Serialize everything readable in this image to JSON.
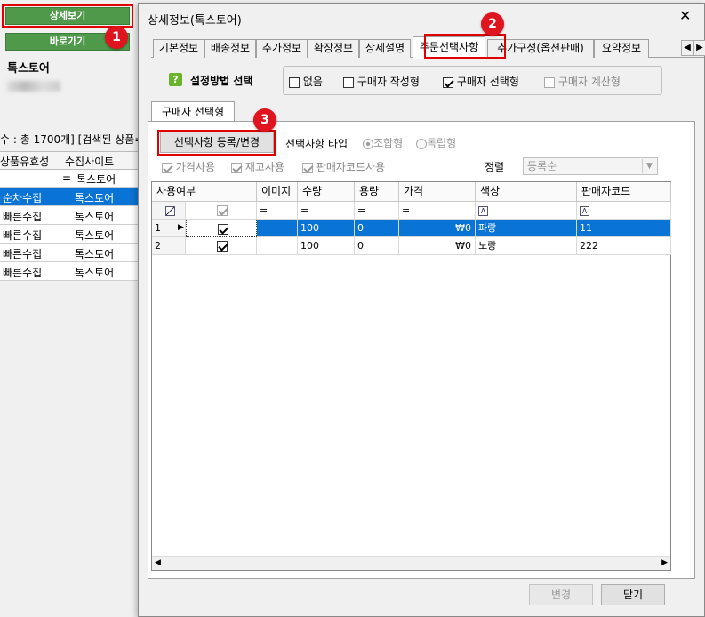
{
  "bg": {
    "detail_btn": "상세보기",
    "goto_btn": "바로가기",
    "store_name": "톡스토어",
    "count_text": "수 : 총 1700개] [검색된 상품=",
    "col_valid": "상품유효성",
    "col_site": "수집사이트",
    "filter_eq": "=",
    "filter_site": "톡스토어",
    "rows": [
      {
        "status": "순차수집",
        "site": "톡스토어"
      },
      {
        "status": "빠른수집",
        "site": "톡스토어"
      },
      {
        "status": "빠른수집",
        "site": "톡스토어"
      },
      {
        "status": "빠른수집",
        "site": "톡스토어"
      },
      {
        "status": "빠른수집",
        "site": "톡스토어"
      }
    ]
  },
  "badges": [
    "1",
    "2",
    "3"
  ],
  "dialog": {
    "title": "상세정보(톡스토어)",
    "tabs": [
      "기본정보",
      "배송정보",
      "추가정보",
      "확장정보",
      "상세설명",
      "주문선택사항",
      "추가구성(옵션판매)",
      "요약정보"
    ],
    "method_label": "설정방법 선택",
    "options": [
      {
        "label": "없음",
        "checked": false
      },
      {
        "label": "구매자 작성형",
        "checked": false
      },
      {
        "label": "구매자 선택형",
        "checked": true
      },
      {
        "label": "구매자 계산형",
        "checked": false
      }
    ],
    "subtab": "구매자 선택형",
    "register_btn": "선택사항 등록/변경",
    "type_label": "선택사항 타입",
    "type_combo": "조합형",
    "type_indep": "독립형",
    "use_price": "가격사용",
    "use_stock": "재고사용",
    "use_code": "판매자코드사용",
    "sort_label": "정렬",
    "sort_value": "등록순",
    "grid": {
      "headers": [
        "사용여부",
        "이미지",
        "수량",
        "용량",
        "가격",
        "색상",
        "판매자코드"
      ],
      "filter_eq": "=",
      "filter_a": "A",
      "rows": [
        {
          "num": "1",
          "qty": "100",
          "cap": "0",
          "price": "₩0",
          "color": "파랑",
          "code": "11"
        },
        {
          "num": "2",
          "qty": "100",
          "cap": "0",
          "price": "₩0",
          "color": "노랑",
          "code": "222"
        }
      ]
    },
    "change_btn": "변경",
    "close_btn": "닫기",
    "colors": {
      "selected_row": "#0a74d6",
      "badge": "#e0141e",
      "green_button": "#4e9a4a"
    }
  }
}
